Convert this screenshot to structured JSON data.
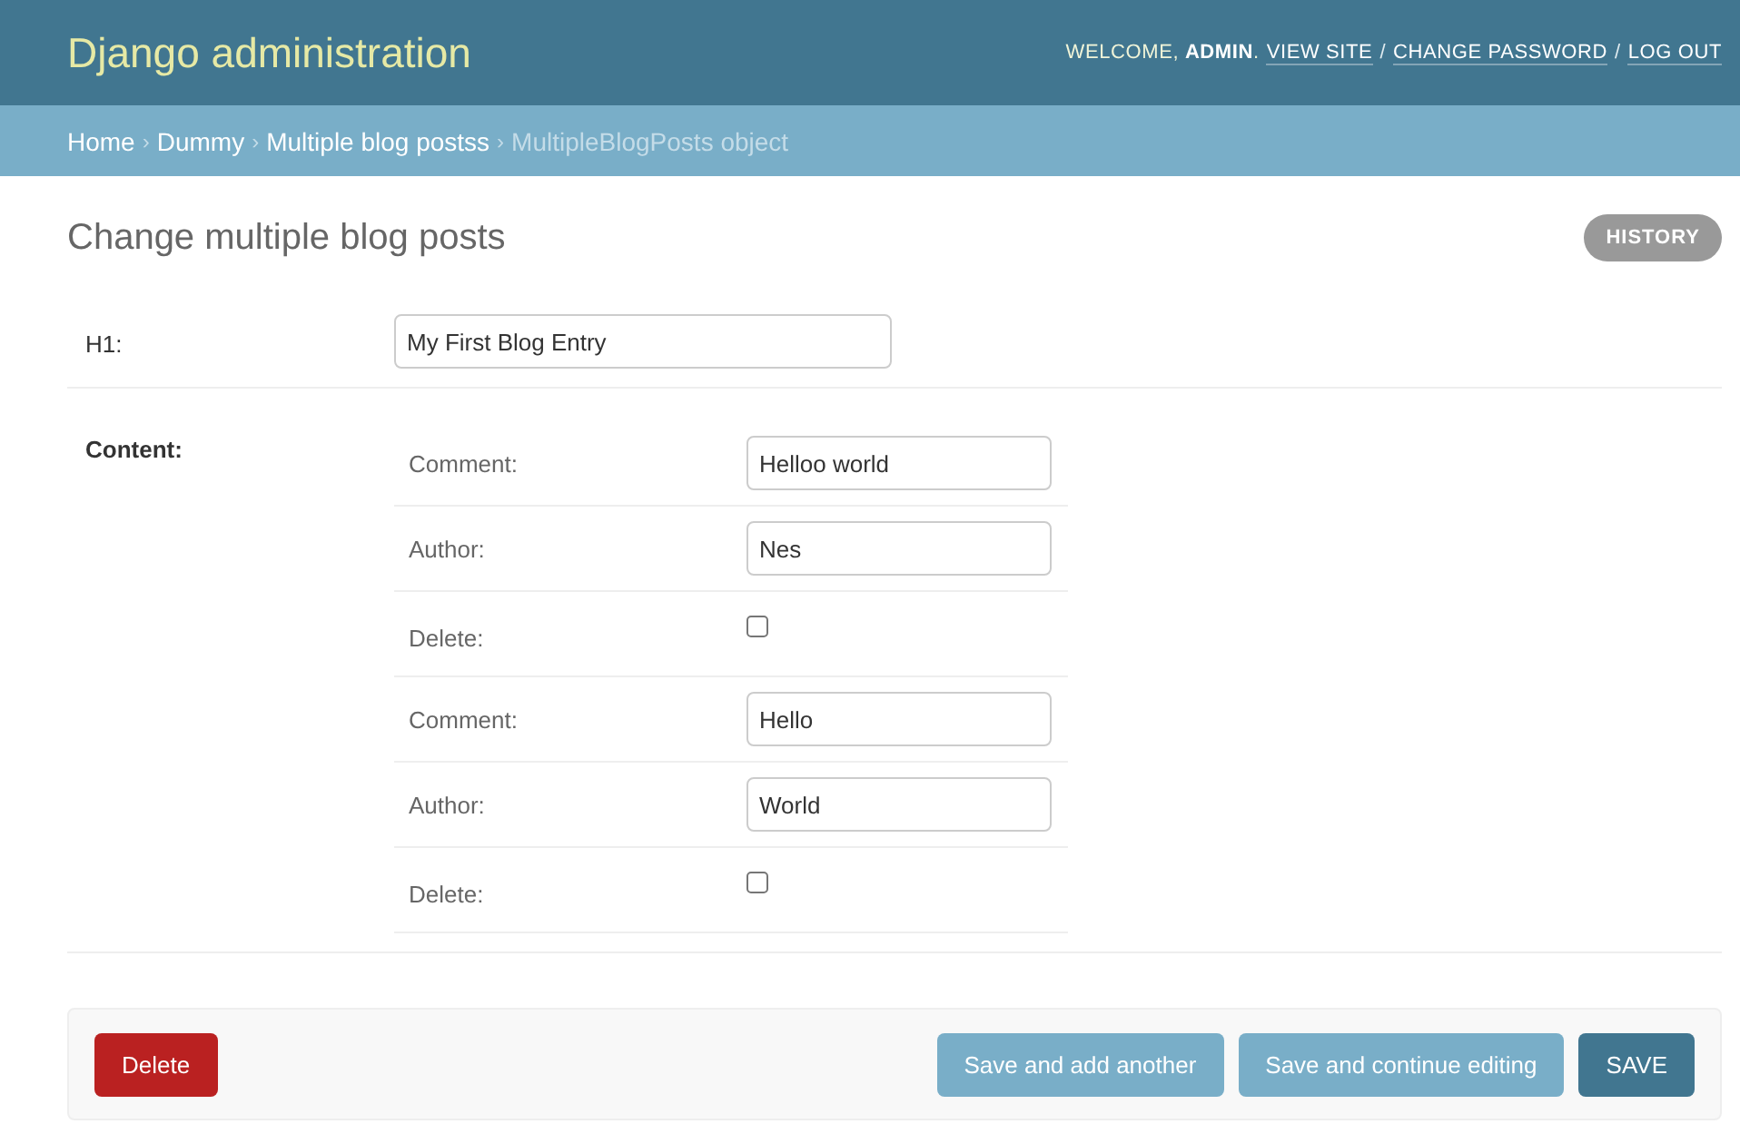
{
  "header": {
    "title": "Django administration",
    "welcome": "WELCOME, **ADMIN**.",
    "links": [
      "VIEW SITE",
      "CHANGE PASSWORD",
      "LOG OUT"
    ],
    "separator": "/"
  },
  "breadcrumbs": {
    "separator": "›",
    "items": [
      {
        "label": "Home",
        "current": false
      },
      {
        "label": "Dummy",
        "current": false
      },
      {
        "label": "Multiple blog postss",
        "current": false
      },
      {
        "label": "MultipleBlogPosts object",
        "current": true
      }
    ]
  },
  "page_title": "Change multiple blog posts",
  "history_button": "HISTORY",
  "h1_field": {
    "label": "H1:",
    "value": "My First Blog Entry"
  },
  "content": {
    "label": "Content:",
    "rows": [
      {
        "kind": "text",
        "label": "Comment:",
        "value": "Helloo world"
      },
      {
        "kind": "text",
        "label": "Author:",
        "value": "Nes"
      },
      {
        "kind": "checkbox",
        "label": "Delete:",
        "checked": false
      },
      {
        "kind": "text",
        "label": "Comment:",
        "value": "Hello"
      },
      {
        "kind": "text",
        "label": "Author:",
        "value": "World"
      },
      {
        "kind": "checkbox",
        "label": "Delete:",
        "checked": false
      }
    ]
  },
  "submit_row": {
    "delete": "Delete",
    "buttons": [
      {
        "label": "Save and add another",
        "kind": "secondary"
      },
      {
        "label": "Save and continue editing",
        "kind": "secondary"
      },
      {
        "label": "SAVE",
        "kind": "primary"
      }
    ]
  }
}
